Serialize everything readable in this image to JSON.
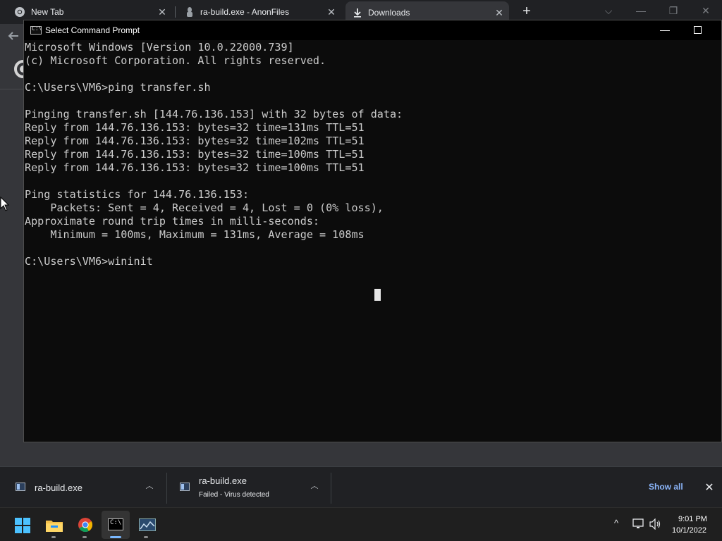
{
  "browser": {
    "tabs": [
      {
        "label": "New Tab",
        "icon": "chrome-icon"
      },
      {
        "label": "ra-build.exe - AnonFiles",
        "icon": "anonfiles-icon"
      },
      {
        "label": "Downloads",
        "icon": "download-icon"
      }
    ],
    "tab_close_glyph": "✕",
    "new_tab_glyph": "+",
    "controls": {
      "search_tabs": "⌵",
      "minimize": "—",
      "restore": "❐",
      "close": "✕"
    }
  },
  "cmd": {
    "title": "Select Command Prompt",
    "icon_text": "C:\\",
    "minimize_glyph": "—",
    "lines": [
      "Microsoft Windows [Version 10.0.22000.739]",
      "(c) Microsoft Corporation. All rights reserved.",
      "",
      "C:\\Users\\VM6>ping transfer.sh",
      "",
      "Pinging transfer.sh [144.76.136.153] with 32 bytes of data:",
      "Reply from 144.76.136.153: bytes=32 time=131ms TTL=51",
      "Reply from 144.76.136.153: bytes=32 time=102ms TTL=51",
      "Reply from 144.76.136.153: bytes=32 time=100ms TTL=51",
      "Reply from 144.76.136.153: bytes=32 time=100ms TTL=51",
      "",
      "Ping statistics for 144.76.136.153:",
      "    Packets: Sent = 4, Received = 4, Lost = 0 (0% loss),",
      "Approximate round trip times in milli-seconds:",
      "    Minimum = 100ms, Maximum = 131ms, Average = 108ms",
      "",
      "C:\\Users\\VM6>wininit"
    ]
  },
  "downloads": {
    "items": [
      {
        "name": "ra-build.exe",
        "status": ""
      },
      {
        "name": "ra-build.exe",
        "status": "Failed - Virus detected"
      }
    ],
    "chevron_glyph": "︿",
    "show_all": "Show all",
    "close_glyph": "✕"
  },
  "taskbar": {
    "apps": [
      "start-icon",
      "file-explorer-icon",
      "chrome-icon",
      "command-prompt-icon",
      "monitor-app-icon"
    ],
    "tray": {
      "chevron": "^",
      "network": "🖥",
      "volume": "🔊"
    },
    "time": "9:01 PM",
    "date": "10/1/2022"
  },
  "colors": {
    "accent": "#8ab4f8",
    "cmd_bg": "#0c0c0c",
    "cmd_text": "#cccccc",
    "start_blue": "#4cc2ff"
  }
}
